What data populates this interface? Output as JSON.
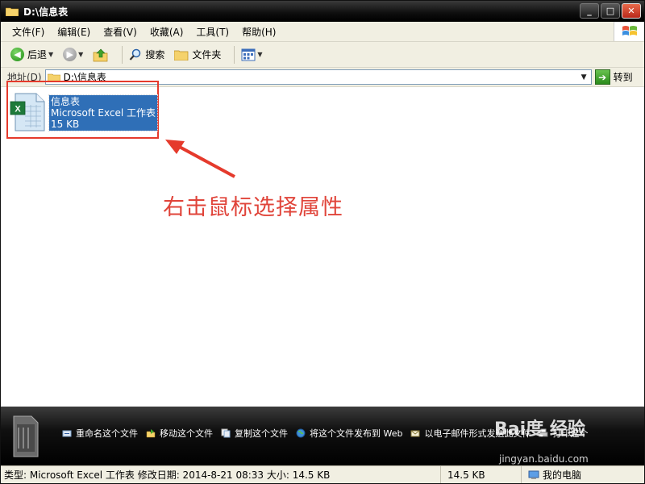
{
  "window": {
    "title": "D:\\信息表",
    "buttons": {
      "minimize": "_",
      "maximize": "□",
      "close": "✕"
    }
  },
  "menu": {
    "items": [
      "文件(F)",
      "编辑(E)",
      "查看(V)",
      "收藏(A)",
      "工具(T)",
      "帮助(H)"
    ]
  },
  "toolbar": {
    "back_label": "后退",
    "search_label": "搜索",
    "folders_label": "文件夹"
  },
  "address": {
    "label": "地址(D)",
    "value": "D:\\信息表",
    "go_label": "转到"
  },
  "file": {
    "name": "信息表",
    "type": "Microsoft Excel 工作表",
    "size": "15 KB"
  },
  "annotation": {
    "text": "右击鼠标选择属性"
  },
  "tasks": {
    "rename": "重命名这个文件",
    "move": "移动这个文件",
    "copy": "复制这个文件",
    "publish": "将这个文件发布到 Web",
    "email": "以电子邮件形式发送此文件",
    "print": "打印这个"
  },
  "watermark": {
    "main": "Bai度 经验",
    "sub": "jingyan.baidu.com"
  },
  "status": {
    "details": "类型: Microsoft Excel 工作表 修改日期: 2014-8-21 08:33 大小: 14.5 KB",
    "size": "14.5 KB",
    "location": "我的电脑"
  },
  "colors": {
    "selection": "#2f6fb7",
    "annotation_red": "#e53a2c",
    "chrome": "#f1efe2"
  }
}
